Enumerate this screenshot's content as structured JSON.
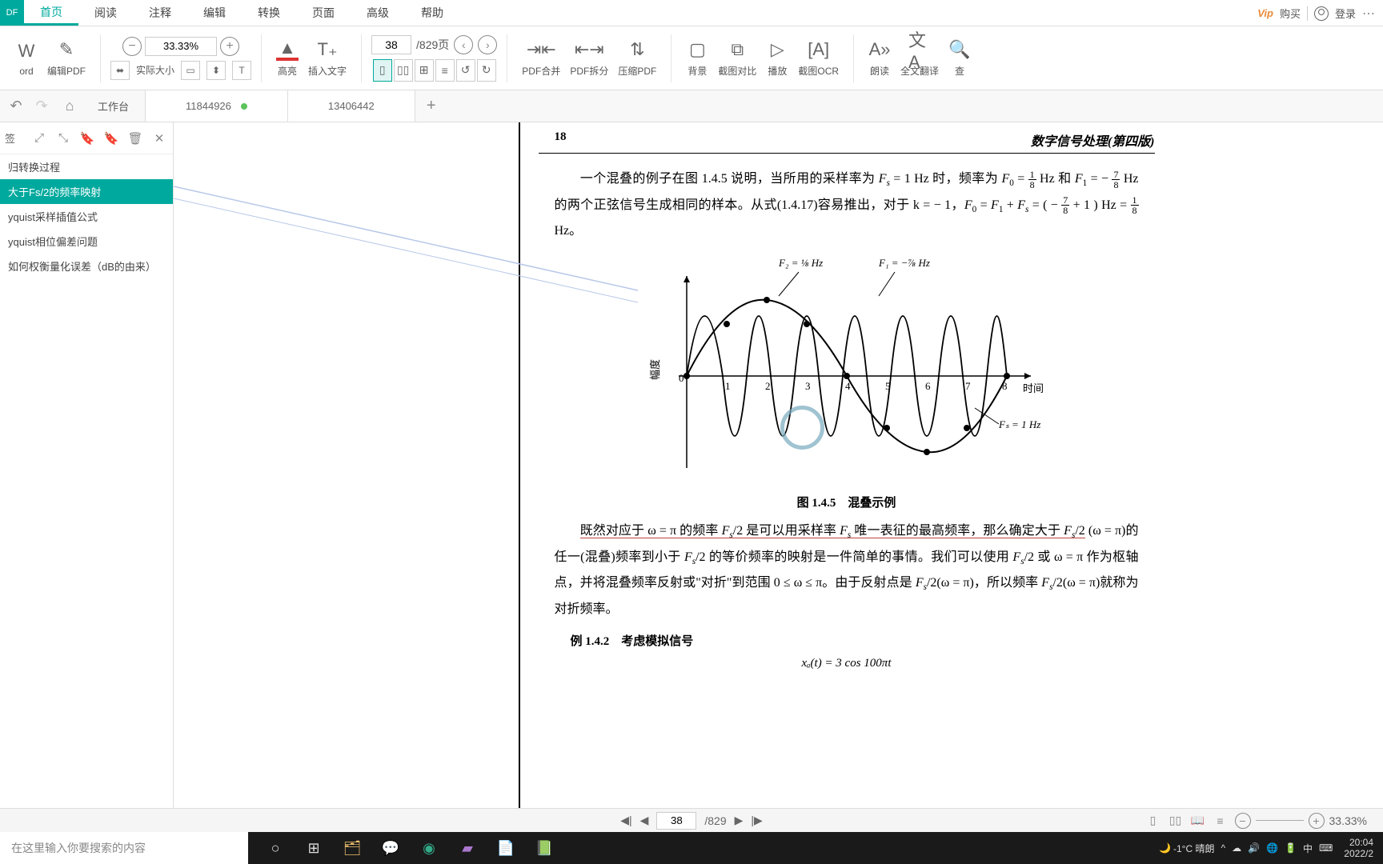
{
  "menubar": {
    "logo": "DF",
    "items": [
      "首页",
      "阅读",
      "注释",
      "编辑",
      "转换",
      "页面",
      "高级",
      "帮助"
    ],
    "activeIndex": 0,
    "right": {
      "vip": "Vip",
      "buy": "购买",
      "login": "登录"
    }
  },
  "toolbar": {
    "word": "ord",
    "editPdf": "编辑PDF",
    "zoomValue": "33.33%",
    "actualSize": "实际大小",
    "highlight": "高亮",
    "insertText": "插入文字",
    "pageCurrent": "38",
    "pageTotal": "/829页",
    "pdfMerge": "PDF合并",
    "pdfSplit": "PDF拆分",
    "pdfCompress": "压缩PDF",
    "background": "背景",
    "compare": "截图对比",
    "play": "播放",
    "ocr": "截图OCR",
    "read": "朗读",
    "translate": "全文翻译",
    "find": "查"
  },
  "tabs": {
    "workspace": "工作台",
    "tab1": "11844926",
    "tab2": "13406442"
  },
  "sidebar": {
    "label": "签",
    "items": [
      "归转换过程",
      "大于Fs/2的频率映射",
      "yquist采样插值公式",
      "yquist相位偏差问题",
      "如何权衡量化误差（dB的由来）"
    ],
    "selectedIndex": 1
  },
  "document": {
    "pageNum": "18",
    "bookTitle": "数字信号处理(第四版)",
    "para1a": "一个混叠的例子在图 1.4.5 说明，当所用的采样率为 ",
    "para1b": " = 1 Hz 时，频率为 ",
    "para1c": " Hz 和 ",
    "para1d": " Hz 的两个正弦信号生成相同的样本。从式(1.4.17)容易推出，对于 k = − 1，",
    "para1e": "。",
    "figLabel1": "F₂ = ⅛ Hz",
    "figLabel2": "F₁ = −⅞ Hz",
    "figLabel3": "Fₛ = 1 Hz",
    "figYLabel": "幅度",
    "figXLabel": "时间",
    "figCaption": "图 1.4.5　混叠示例",
    "para2": "既然对应于 ω = π 的频率 Fₛ/2 是可以用采样率 Fₛ 唯一表征的最高频率，那么确定大于 Fₛ/2 (ω = π)的任一(混叠)频率到小于 Fₛ/2 的等价频率的映射是一件简单的事情。我们可以使用 Fₛ/2 或 ω = π 作为枢轴点，并将混叠频率反射或\"对折\"到范围 0 ≤ ω ≤ π。由于反射点是 Fₛ/2(ω = π)，所以频率 Fₛ/2(ω = π)就称为对折频率。",
    "example": "例 1.4.2　考虑模拟信号",
    "equation": "xₐ(t) = 3 cos 100πt"
  },
  "chart_data": {
    "type": "line",
    "title": "图 1.4.5 混叠示例",
    "xlabel": "时间",
    "ylabel": "幅度",
    "xlim": [
      0,
      8
    ],
    "ylim": [
      -1,
      1
    ],
    "xticks": [
      1,
      2,
      3,
      4,
      5,
      6,
      7,
      8
    ],
    "series": [
      {
        "name": "F₂ = 1/8 Hz",
        "type": "sine",
        "frequency_hz": 0.125,
        "amplitude": 1
      },
      {
        "name": "F₁ = -7/8 Hz",
        "type": "sine",
        "frequency_hz": 0.875,
        "amplitude": 1
      }
    ],
    "sample_points": {
      "Fs": 1,
      "x": [
        0,
        1,
        2,
        3,
        4,
        5,
        6,
        7,
        8
      ],
      "y": [
        0,
        0.707,
        1.0,
        0.707,
        0,
        -0.707,
        -1.0,
        -0.707,
        0
      ]
    }
  },
  "statusbar": {
    "page": "38",
    "total": "/829",
    "zoom": "33.33%"
  },
  "taskbar": {
    "searchPlaceholder": "在这里输入你要搜索的内容",
    "weather": "-1°C 晴朗",
    "ime": "中",
    "time": "20:04",
    "date": "2022/2"
  }
}
